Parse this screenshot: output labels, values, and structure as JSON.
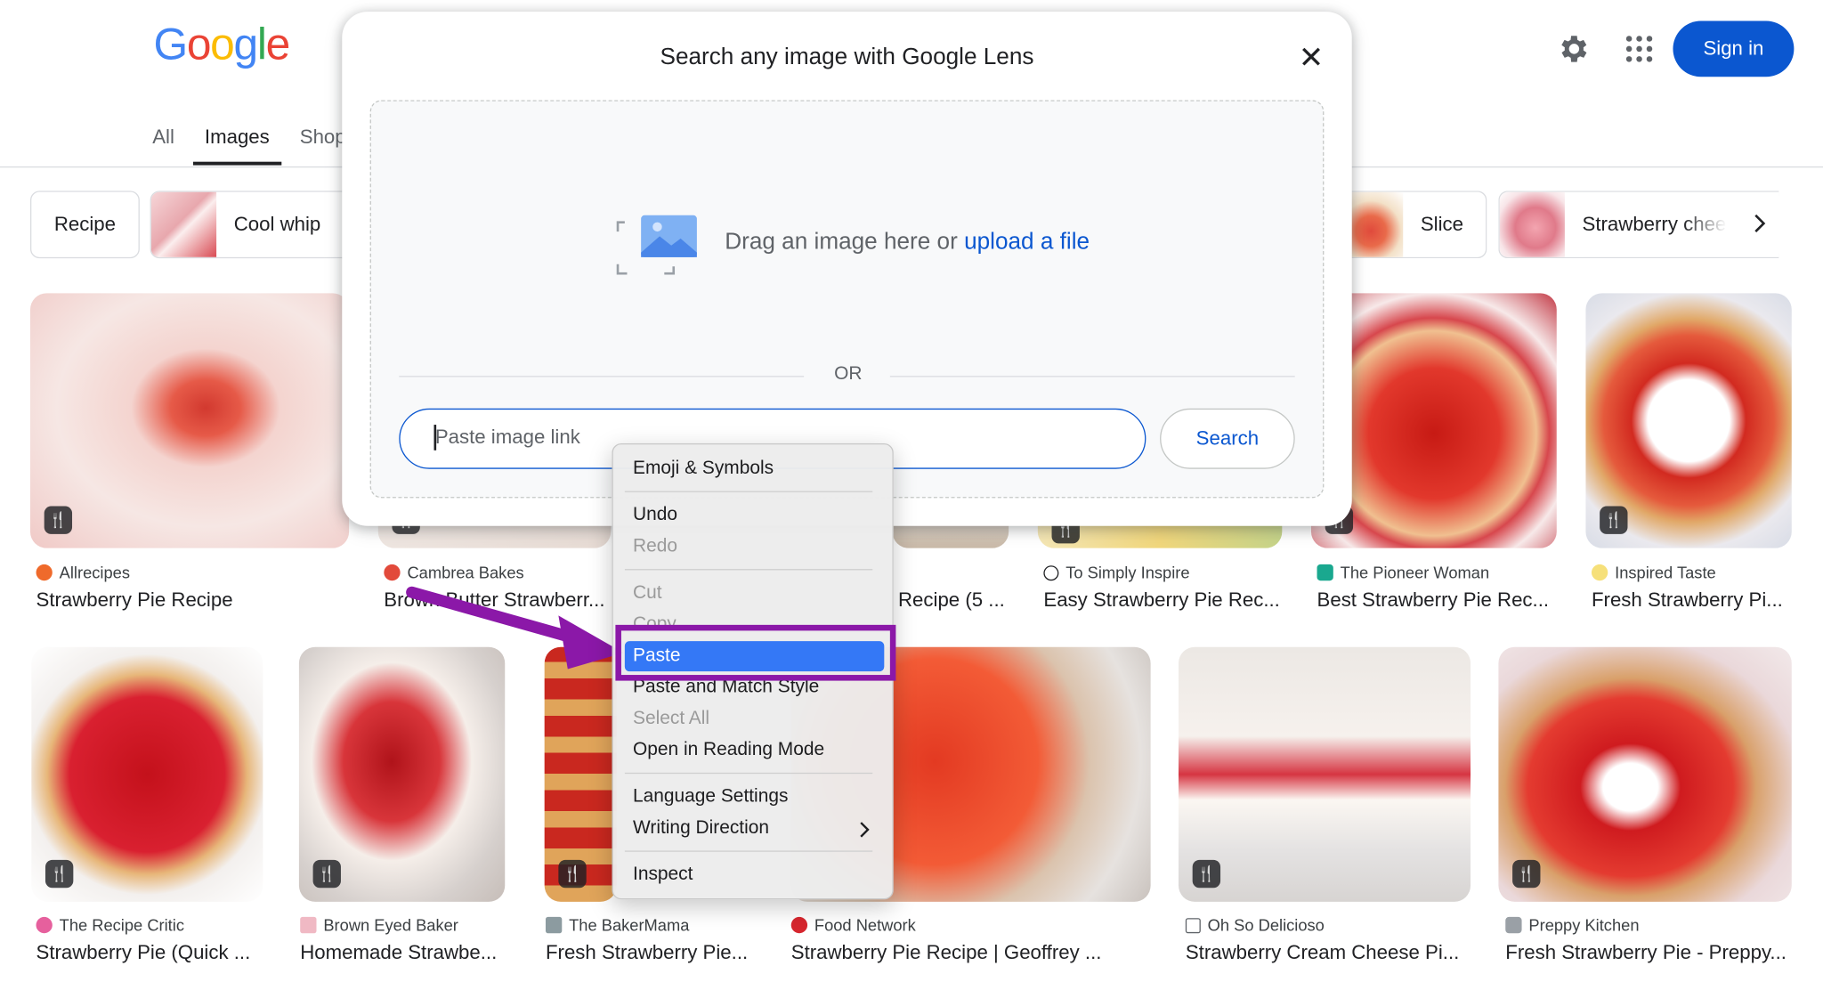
{
  "header": {
    "logo_letters": [
      "G",
      "o",
      "o",
      "g",
      "l",
      "e"
    ],
    "logo_colors": [
      "#4285f4",
      "#ea4335",
      "#fbbc05",
      "#4285f4",
      "#34a853",
      "#ea4335"
    ],
    "settings_icon": "gear-icon",
    "apps_icon": "grid-icon",
    "sign_in_label": "Sign in"
  },
  "tabs": [
    {
      "label": "All",
      "active": false
    },
    {
      "label": "Images",
      "active": true
    },
    {
      "label": "Shop",
      "active": false
    }
  ],
  "chips": [
    {
      "label": "Recipe"
    },
    {
      "label": "Cool whip"
    },
    {
      "label": "Slice"
    },
    {
      "label": "Strawberry chee"
    }
  ],
  "results_row1": [
    {
      "source": "Allrecipes",
      "title": "Strawberry Pie Recipe"
    },
    {
      "source": "Cambrea Bakes",
      "title": "Brown Butter Strawberr..."
    },
    {
      "source": "",
      "title": "Recipe (5 ..."
    },
    {
      "source": "To Simply Inspire",
      "title": "Easy Strawberry Pie Rec..."
    },
    {
      "source": "The Pioneer Woman",
      "title": "Best Strawberry Pie Rec..."
    },
    {
      "source": "Inspired Taste",
      "title": "Fresh Strawberry Pi..."
    }
  ],
  "results_row2": [
    {
      "source": "The Recipe Critic",
      "title": "Strawberry Pie (Quick ..."
    },
    {
      "source": "Brown Eyed Baker",
      "title": "Homemade Strawbe..."
    },
    {
      "source": "The BakerMama",
      "title": "Fresh Strawberry Pie..."
    },
    {
      "source": "Food Network",
      "title": "Strawberry Pie Recipe | Geoffrey ..."
    },
    {
      "source": "Oh So Delicioso",
      "title": "Strawberry Cream Cheese Pi..."
    },
    {
      "source": "Preppy Kitchen",
      "title": "Fresh Strawberry Pie - Preppy..."
    }
  ],
  "lens_modal": {
    "title": "Search any image with Google Lens",
    "drag_text": "Drag an image here or",
    "upload_link": "upload a file",
    "or_label": "OR",
    "input_placeholder": "Paste image link",
    "search_label": "Search"
  },
  "context_menu": {
    "items": [
      {
        "label": "Emoji & Symbols",
        "disabled": false
      },
      {
        "label": "Undo",
        "disabled": false
      },
      {
        "label": "Redo",
        "disabled": true
      },
      {
        "label": "Cut",
        "disabled": true
      },
      {
        "label": "Copy",
        "disabled": true
      },
      {
        "label": "Paste",
        "disabled": false,
        "highlighted": true
      },
      {
        "label": "Paste and Match Style",
        "disabled": false
      },
      {
        "label": "Select All",
        "disabled": true
      },
      {
        "label": "Open in Reading Mode",
        "disabled": false
      },
      {
        "label": "Language Settings",
        "disabled": false
      },
      {
        "label": "Writing Direction",
        "disabled": false
      },
      {
        "label": "Inspect",
        "disabled": false
      }
    ]
  },
  "annotation": {
    "color": "#8b18a8"
  }
}
